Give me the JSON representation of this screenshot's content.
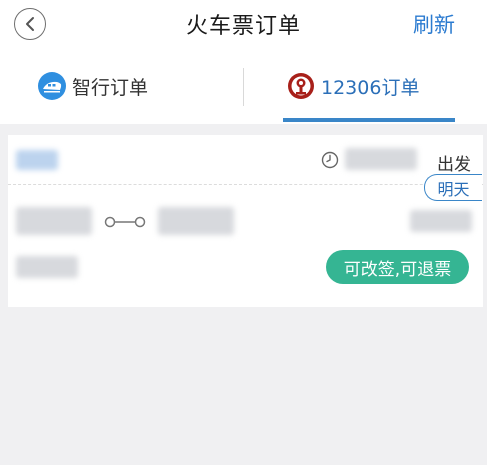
{
  "header": {
    "title": "火车票订单",
    "refresh_label": "刷新"
  },
  "tabs": [
    {
      "label": "智行订单",
      "icon": "zhixing-train-logo"
    },
    {
      "label": "12306订单",
      "icon": "railway-12306-logo",
      "active": true
    }
  ],
  "order": {
    "depart_label": "出发",
    "day_badge": "明天",
    "status": "可改签,可退票"
  },
  "colors": {
    "accent": "#2b7bd0",
    "status_green": "#35b593",
    "railway_red": "#a8201a"
  }
}
